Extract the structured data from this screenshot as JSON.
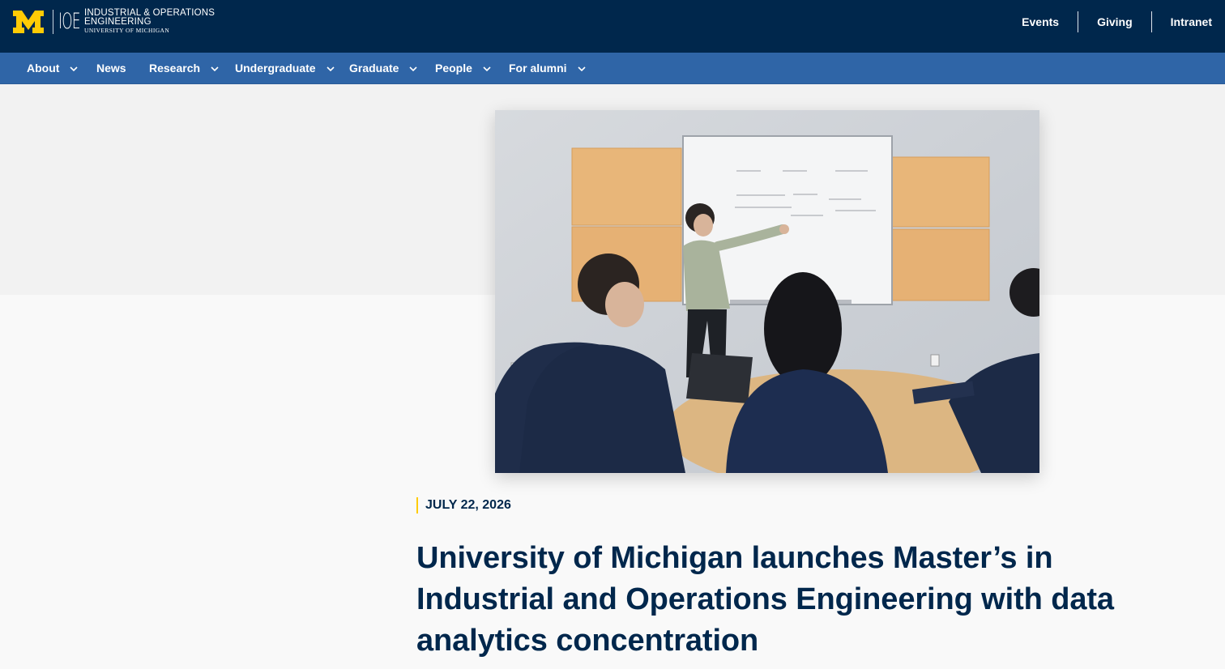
{
  "brand": {
    "block_m_icon": "block-m-logo",
    "monogram": "IOE",
    "line1": "INDUSTRIAL & OPERATIONS",
    "line2": "ENGINEERING",
    "line3": "UNIVERSITY OF MICHIGAN"
  },
  "utility_nav": [
    "Events",
    "Giving",
    "Intranet"
  ],
  "main_nav": [
    {
      "label": "About",
      "has_dropdown": true
    },
    {
      "label": "News",
      "has_dropdown": false
    },
    {
      "label": "Research",
      "has_dropdown": true
    },
    {
      "label": "Undergraduate",
      "has_dropdown": true
    },
    {
      "label": "Graduate",
      "has_dropdown": true
    },
    {
      "label": "People",
      "has_dropdown": true
    },
    {
      "label": "For alumni",
      "has_dropdown": true
    }
  ],
  "article": {
    "image_icon": "classroom-photo",
    "date": "JULY 22, 2026",
    "title": "University of Michigan launches Master’s in Industrial and Operations Engineering with data analytics concentration"
  },
  "colors": {
    "navy": "#00274c",
    "nav_blue": "#2f65a7",
    "maize": "#ffcb05",
    "page_bg": "#f9f9f9",
    "band_bg": "#f2f2f2"
  }
}
